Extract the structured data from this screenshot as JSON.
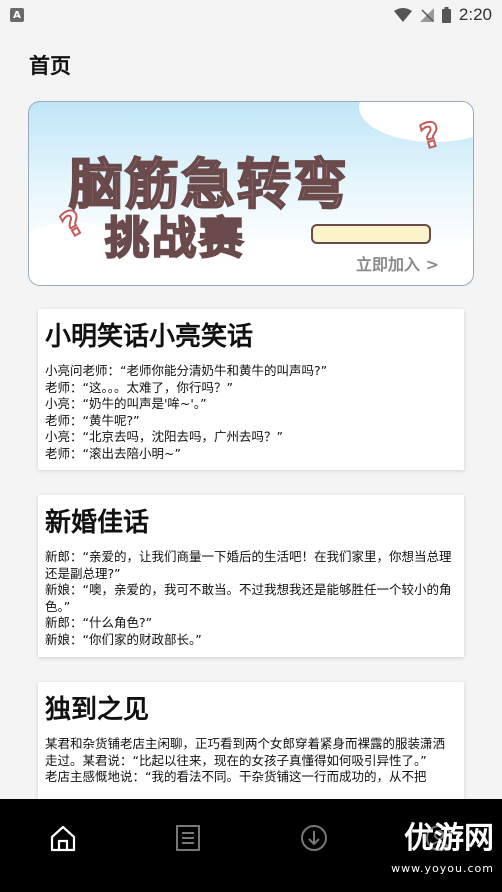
{
  "status_bar": {
    "app_icon_letter": "A",
    "time": "2:20",
    "icons": [
      "wifi-icon",
      "signal-icon",
      "battery-icon"
    ]
  },
  "header": {
    "title": "首页"
  },
  "banner": {
    "title_line1": "脑筋急转弯",
    "title_line2": "挑战赛",
    "cta": "立即加入 >"
  },
  "articles": [
    {
      "title": "小明笑话小亮笑话",
      "lines": [
        "小亮问老师：“老师你能分清奶牛和黄牛的叫声吗?”",
        "老师：“这。。。太难了，你行吗？”",
        "小亮：“奶牛的叫声是'哞~'。”",
        "老师：“黄牛呢?”",
        "小亮：“北京去吗，沈阳去吗，广州去吗？”",
        "老师：“滚出去陪小明~”"
      ]
    },
    {
      "title": "新婚佳话",
      "lines": [
        "新郎：“亲爱的，让我们商量一下婚后的生活吧！在我们家里，你想当总理还是副总理?”",
        "新娘：“噢，亲爱的，我可不敢当。不过我想我还是能够胜任一个较小的角色。”",
        "新郎：“什么角色?”",
        "新娘：“你们家的财政部长。”"
      ]
    },
    {
      "title": "独到之见",
      "lines": [
        "某君和杂货铺老店主闲聊，正巧看到两个女郎穿着紧身而裸露的服装潇洒走过。某君说：“比起以往来，现在的女孩子真懂得如何吸引异性了。”",
        "老店主感慨地说：“我的看法不同。干杂货铺这一行而成功的，从不把"
      ]
    }
  ],
  "bottom_nav": {
    "items": [
      "home-icon",
      "list-icon",
      "download-icon",
      "profile-icon"
    ],
    "active": "home-icon"
  },
  "watermark": {
    "main": "优游网",
    "sub": "www.yoyou.com"
  },
  "colors": {
    "background": "#f4f4f4",
    "nav_bg": "#000000",
    "banner_text": "#f4b3c7"
  }
}
